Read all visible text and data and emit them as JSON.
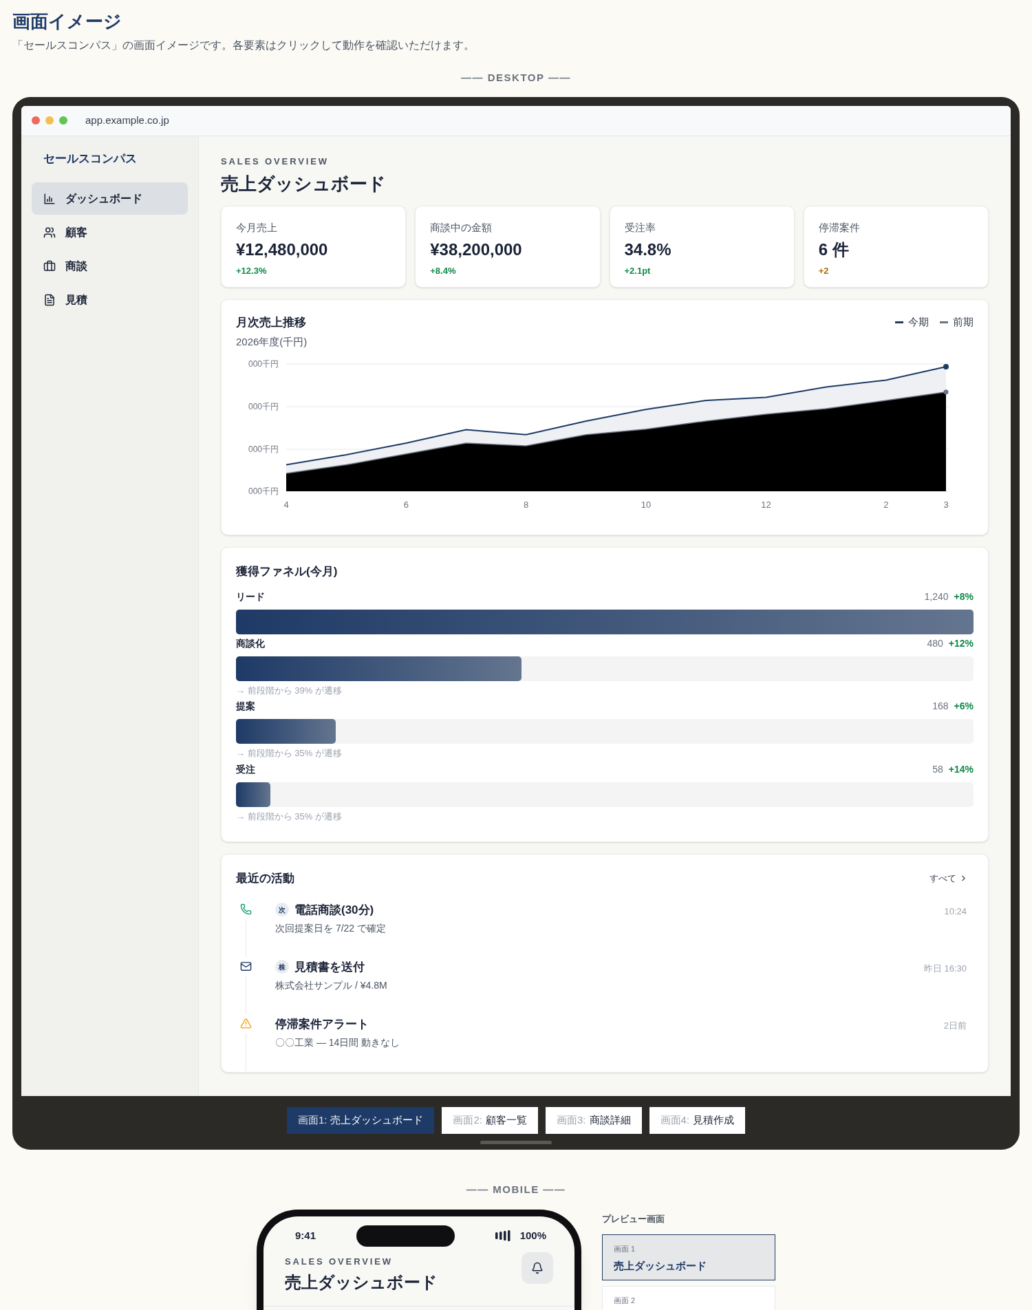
{
  "page": {
    "title": "画面イメージ",
    "description": "「セールスコンパス」の画面イメージです。各要素はクリックして動作を確認いただけます。",
    "desktop_label": "—— DESKTOP ——",
    "mobile_label": "—— MOBILE ——"
  },
  "browser": {
    "url": "app.example.co.jp"
  },
  "sidebar": {
    "brand": "セールスコンパス",
    "items": [
      {
        "kind": "chart",
        "label": "ダッシュボード",
        "selected": true
      },
      {
        "kind": "users",
        "label": "顧客",
        "selected": false
      },
      {
        "kind": "briefcase",
        "label": "商談",
        "selected": false
      },
      {
        "kind": "file",
        "label": "見積",
        "selected": false
      }
    ]
  },
  "header": {
    "eyebrow": "SALES OVERVIEW",
    "title": "売上ダッシュボード"
  },
  "kpis": [
    {
      "label": "今月売上",
      "value": "¥12,480,000",
      "delta": "+12.3%",
      "color": "#0f8a4a"
    },
    {
      "label": "商談中の金額",
      "value": "¥38,200,000",
      "delta": "+8.4%",
      "color": "#0f8a4a"
    },
    {
      "label": "受注率",
      "value": "34.8%",
      "delta": "+2.1pt",
      "color": "#0f8a4a"
    },
    {
      "label": "停滞案件",
      "value": "6 件",
      "delta": "+2",
      "color": "#b06a00"
    }
  ],
  "sales_chart": {
    "title": "月次売上推移",
    "subtitle": "2026年度(千円)",
    "legend": [
      {
        "label": "今期",
        "color": "#1e3a66"
      },
      {
        "label": "前期",
        "color": "#6b7280"
      }
    ],
    "y_axis_labels": [
      "000千円",
      "000千円",
      "000千円",
      "000千円"
    ],
    "x_axis_labels": [
      "4",
      "6",
      "8",
      "10",
      "12",
      "2",
      "3"
    ]
  },
  "funnel": {
    "title": "獲得ファネル(今月)",
    "stages": [
      {
        "label": "リード",
        "count": "1,240",
        "delta": "+8%",
        "level": 1.0
      },
      {
        "label": "商談化",
        "count": "480",
        "delta": "+12%",
        "level": 0.387,
        "note": "→ 前段階から 39% が遷移"
      },
      {
        "label": "提案",
        "count": "168",
        "delta": "+6%",
        "level": 0.135,
        "note": "→ 前段階から 35% が遷移"
      },
      {
        "label": "受注",
        "count": "58",
        "delta": "+14%",
        "level": 0.047,
        "note": "→ 前段階から 35% が遷移"
      }
    ]
  },
  "activity": {
    "title": "最近の活動",
    "link": "すべて",
    "items": [
      {
        "kind": "call",
        "badge": "次",
        "title": "電話商談(30分)",
        "detail": "次回提案日を 7/22 で確定",
        "time": "10:24"
      },
      {
        "kind": "mail",
        "badge": "株",
        "title": "見積書を送付",
        "detail": "株式会社サンプル / ¥4.8M",
        "time": "昨日 16:30"
      },
      {
        "kind": "alert",
        "title": "停滞案件アラート",
        "detail": "〇〇工業 — 14日間 動きなし",
        "time": "2日前"
      }
    ]
  },
  "screen_tabs": [
    {
      "prefix": "画面1:",
      "name": "売上ダッシュボード",
      "selected": true
    },
    {
      "prefix": "画面2:",
      "name": "顧客一覧",
      "selected": false
    },
    {
      "prefix": "画面3:",
      "name": "商談詳細",
      "selected": false
    },
    {
      "prefix": "画面4:",
      "name": "見積作成",
      "selected": false
    }
  ],
  "mobile": {
    "time": "9:41",
    "battery": "100%",
    "eyebrow": "SALES OVERVIEW",
    "title": "売上ダッシュボード"
  },
  "preview": {
    "title": "プレビュー画面",
    "items": [
      {
        "number": "画面 1",
        "name": "売上ダッシュボード",
        "selected": true
      },
      {
        "number": "画面 2",
        "selected": false
      }
    ]
  }
}
